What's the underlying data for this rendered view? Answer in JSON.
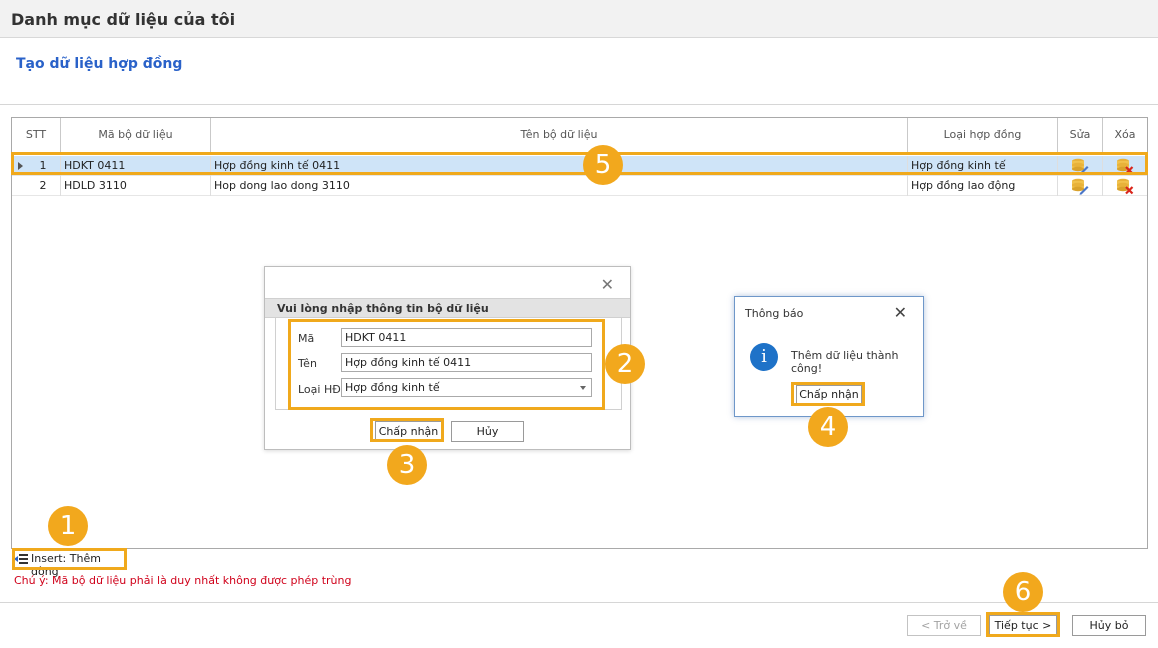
{
  "window": {
    "title": "Danh mục dữ liệu của tôi"
  },
  "page": {
    "subtitle": "Tạo dữ liệu hợp đồng"
  },
  "table": {
    "columns": [
      "STT",
      "Mã bộ dữ liệu",
      "Tên bộ dữ liệu",
      "Loại hợp đồng",
      "Sửa",
      "Xóa"
    ],
    "rows": [
      {
        "stt": "1",
        "code": "HDKT 0411",
        "name": "Hợp đồng kinh tế 0411",
        "type": "Hợp đồng kinh tế"
      },
      {
        "stt": "2",
        "code": "HDLD 3110",
        "name": "Hop dong lao dong 3110",
        "type": "Hợp đồng lao động"
      }
    ],
    "edit_icon": "edit-pencil-icon",
    "delete_icon": "delete-x-icon"
  },
  "insert": {
    "label": "Insert: Thêm dòng",
    "icon": "insert-row-icon"
  },
  "note": "Chú ý: Mã bộ dữ liệu phải là duy nhất không được phép trùng",
  "input_dialog": {
    "header": "Vui lòng nhập thông tin bộ dữ liệu",
    "fields": [
      {
        "label": "Mã",
        "value": "HDKT 0411"
      },
      {
        "label": "Tên",
        "value": "Hợp đồng kinh tế 0411"
      },
      {
        "label": "Loại HĐ",
        "value": "Hợp đồng kinh tế"
      }
    ],
    "ok_label": "Chấp nhận",
    "cancel_label": "Hủy",
    "close_glyph": "✕"
  },
  "message_dialog": {
    "title": "Thông báo",
    "message": "Thêm dữ liệu thành công!",
    "ok_label": "Chấp nhận",
    "close_glyph": "✕",
    "info_glyph": "i"
  },
  "footer": {
    "back_label": "< Trở về",
    "next_label": "Tiếp tục >",
    "cancel_label": "Hủy bỏ"
  },
  "callouts": [
    "1",
    "2",
    "3",
    "4",
    "5",
    "6"
  ],
  "colors": {
    "highlight": "#f0a91c",
    "badge": "#f2a81d",
    "selected_row": "#cfe4f8",
    "subtitle": "#2a62c9",
    "note": "#d0021b",
    "info": "#1e72c8"
  }
}
